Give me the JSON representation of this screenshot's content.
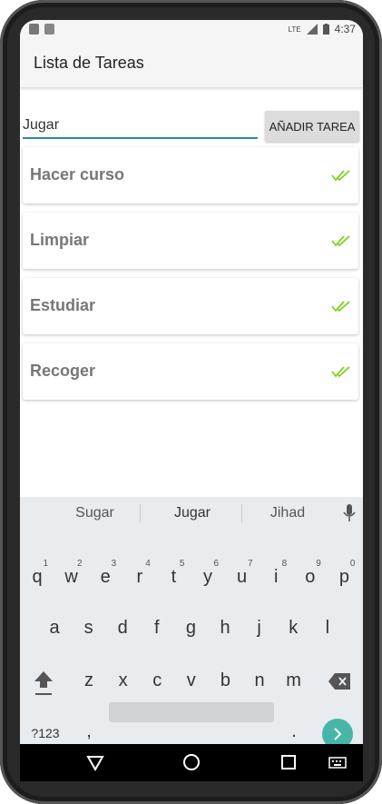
{
  "status": {
    "time": "4:37",
    "network": "LTE"
  },
  "appbar": {
    "title": "Lista de Tareas"
  },
  "input": {
    "value": "Jugar"
  },
  "add_button": {
    "label": "AÑADIR TAREA"
  },
  "tasks": [
    {
      "label": "Hacer curso"
    },
    {
      "label": "Limpiar"
    },
    {
      "label": "Estudiar"
    },
    {
      "label": "Recoger"
    }
  ],
  "keyboard": {
    "suggestions": [
      "Sugar",
      "Jugar",
      "Jihad"
    ],
    "row1": [
      "q",
      "w",
      "e",
      "r",
      "t",
      "y",
      "u",
      "i",
      "o",
      "p"
    ],
    "row1_nums": [
      "1",
      "2",
      "3",
      "4",
      "5",
      "6",
      "7",
      "8",
      "9",
      "0"
    ],
    "row2": [
      "a",
      "s",
      "d",
      "f",
      "g",
      "h",
      "j",
      "k",
      "l"
    ],
    "row3": [
      "z",
      "x",
      "c",
      "v",
      "b",
      "n",
      "m"
    ],
    "symbols": "?123",
    "comma": ",",
    "period": "."
  },
  "colors": {
    "accent": "#2d8f86",
    "check": "#7ed321",
    "enter": "#47b5a8"
  },
  "icons": [
    "mic-icon",
    "shift-icon",
    "backspace-icon",
    "enter-icon",
    "back-icon",
    "home-icon",
    "recents-icon",
    "keyboard-icon",
    "check-icon"
  ]
}
